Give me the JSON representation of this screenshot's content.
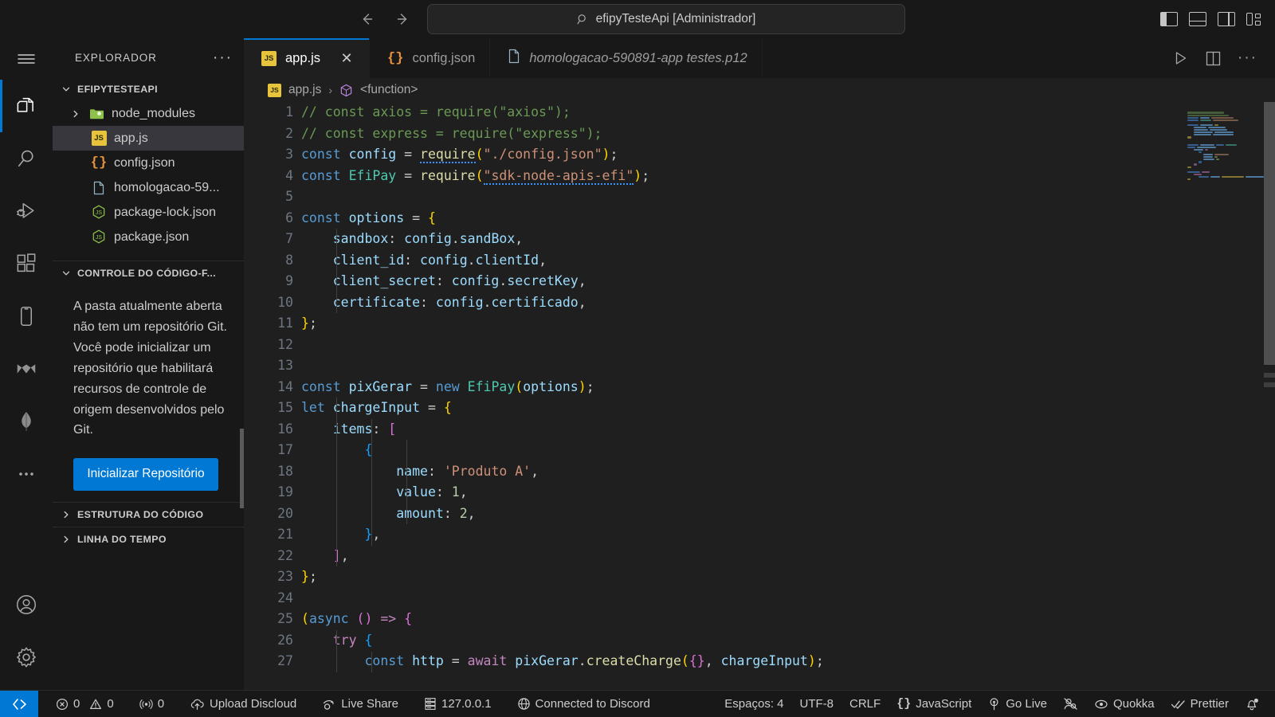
{
  "titlebar": {
    "back_icon": "arrow-left-icon",
    "forward_icon": "arrow-right-icon",
    "search_icon": "search-icon",
    "command_center_text": "efipyTesteApi [Administrador]",
    "layout_buttons": [
      {
        "name": "toggle-primary-sidebar",
        "label": "Alternar Barra Lateral Primária"
      },
      {
        "name": "toggle-panel",
        "label": "Alternar Painel"
      },
      {
        "name": "toggle-secondary-sidebar",
        "label": "Alternar Barra Lateral Secundária"
      },
      {
        "name": "customize-layout",
        "label": "Personalizar Layout"
      }
    ]
  },
  "activitybar": {
    "menu_label": "Menu",
    "items": [
      {
        "name": "explorer",
        "label": "Explorador",
        "active": true
      },
      {
        "name": "search",
        "label": "Pesquisar",
        "active": false
      },
      {
        "name": "run-debug",
        "label": "Executar e Depurar",
        "active": false
      },
      {
        "name": "extensions",
        "label": "Extensões",
        "active": false
      },
      {
        "name": "device-preview",
        "label": "Visualização de Dispositivo",
        "active": false
      },
      {
        "name": "discloud",
        "label": "Discloud",
        "active": false
      },
      {
        "name": "mongodb",
        "label": "MongoDB",
        "active": false
      },
      {
        "name": "more-views",
        "label": "Exibições Adicionais",
        "active": false
      }
    ],
    "bottom_items": [
      {
        "name": "accounts",
        "label": "Contas"
      },
      {
        "name": "settings",
        "label": "Gerenciar"
      }
    ]
  },
  "sidebar": {
    "title": "EXPLORADOR",
    "more_actions_label": "Exibir e Mais Ações...",
    "explorer": {
      "root_label": "EFIPYTESTEAPI",
      "expanded": true,
      "items": [
        {
          "name": "node_modules",
          "icon": "folder-icon",
          "kind": "folder",
          "expanded": false,
          "selected": false,
          "indent": 1
        },
        {
          "name": "app.js",
          "icon": "js-icon",
          "kind": "file",
          "selected": true,
          "indent": 2
        },
        {
          "name": "config.json",
          "icon": "json-icon",
          "kind": "file",
          "selected": false,
          "indent": 2
        },
        {
          "name": "homologacao-59...",
          "icon": "file-icon",
          "kind": "file",
          "selected": false,
          "indent": 2
        },
        {
          "name": "package-lock.json",
          "icon": "nodejs-icon",
          "kind": "file",
          "selected": false,
          "indent": 2
        },
        {
          "name": "package.json",
          "icon": "nodejs-icon",
          "kind": "file",
          "selected": false,
          "indent": 2
        }
      ]
    },
    "source_control": {
      "title": "CONTROLE DO CÓDIGO-F...",
      "message": "A pasta atualmente aberta não tem um repositório Git. Você pode inicializar um repositório que habilitará recursos de controle de origem desenvolvidos pelo Git.",
      "button_label": "Inicializar Repositório"
    },
    "outline": {
      "title": "ESTRUTURA DO CÓDIGO"
    },
    "timeline": {
      "title": "LINHA DO TEMPO"
    }
  },
  "editor": {
    "tabs": [
      {
        "label": "app.js",
        "icon": "js-icon",
        "active": true,
        "italic": false,
        "has_close": true
      },
      {
        "label": "config.json",
        "icon": "json-icon",
        "active": false,
        "italic": false,
        "has_close": false
      },
      {
        "label": "homologacao-590891-app testes.p12",
        "icon": "file-icon",
        "active": false,
        "italic": true,
        "has_close": false
      }
    ],
    "close_glyph": "✕",
    "actions": [
      {
        "name": "run-file-button",
        "label": "Executar Código"
      },
      {
        "name": "split-editor-button",
        "label": "Dividir Editor à Direita"
      },
      {
        "name": "more-actions-button",
        "label": "Mais Ações..."
      }
    ],
    "breadcrumb": {
      "file_icon": "js-icon",
      "file": "app.js",
      "separator": "›",
      "symbol_icon": "symbol-module-icon",
      "symbol": "<function>"
    },
    "code": {
      "language": "JavaScript",
      "first_line": 1,
      "lines": [
        "// const axios = require(\"axios\");",
        "// const express = require(\"express\");",
        "const config = require(\"./config.json\");",
        "const EfiPay = require(\"sdk-node-apis-efi\");",
        "",
        "const options = {",
        "    sandbox: config.sandBox,",
        "    client_id: config.clientId,",
        "    client_secret: config.secretKey,",
        "    certificate: config.certificado,",
        "};",
        "",
        "",
        "const pixGerar = new EfiPay(options);",
        "let chargeInput = {",
        "    items: [",
        "        {",
        "            name: 'Produto A',",
        "            value: 1,",
        "            amount: 2,",
        "        },",
        "    ],",
        "};",
        "",
        "(async () => {",
        "    try {",
        "        const http = await pixGerar.createCharge({}, chargeInput);"
      ]
    }
  },
  "statusbar": {
    "remote_icon": "remote-window-icon",
    "left_items": [
      {
        "name": "problems-errors",
        "icon": "error-icon",
        "label": "0"
      },
      {
        "name": "problems-warnings",
        "icon": "warning-icon",
        "label": "0"
      },
      {
        "name": "ports",
        "icon": "radio-tower-icon",
        "label": "0"
      },
      {
        "name": "upload-discloud",
        "icon": "cloud-upload-icon",
        "label": "Upload Discloud"
      },
      {
        "name": "live-share",
        "icon": "live-share-icon",
        "label": "Live Share"
      },
      {
        "name": "local-server",
        "icon": "server-icon",
        "label": "127.0.0.1"
      },
      {
        "name": "discord-status",
        "icon": "globe-icon",
        "label": "Connected to Discord"
      }
    ],
    "right_items": [
      {
        "name": "indentation",
        "icon": "",
        "label": "Espaços: 4"
      },
      {
        "name": "encoding",
        "icon": "",
        "label": "UTF-8"
      },
      {
        "name": "eol",
        "icon": "",
        "label": "CRLF"
      },
      {
        "name": "language-mode",
        "icon": "json-braces-icon",
        "label": "JavaScript"
      },
      {
        "name": "go-live",
        "icon": "broadcast-icon",
        "label": "Go Live"
      },
      {
        "name": "quokka-toggle",
        "icon": "quokka-off-icon",
        "label": ""
      },
      {
        "name": "quokka",
        "icon": "eye-icon",
        "label": "Quokka"
      },
      {
        "name": "prettier",
        "icon": "check-all-icon",
        "label": "Prettier"
      },
      {
        "name": "notifications",
        "icon": "bell-dot-icon",
        "label": ""
      }
    ]
  },
  "colors": {
    "accent": "#0078d4",
    "titlebar_bg": "#181818",
    "editor_bg": "#1f1f1f",
    "sidebar_bg": "#181818",
    "selection_bg": "#37373d"
  }
}
